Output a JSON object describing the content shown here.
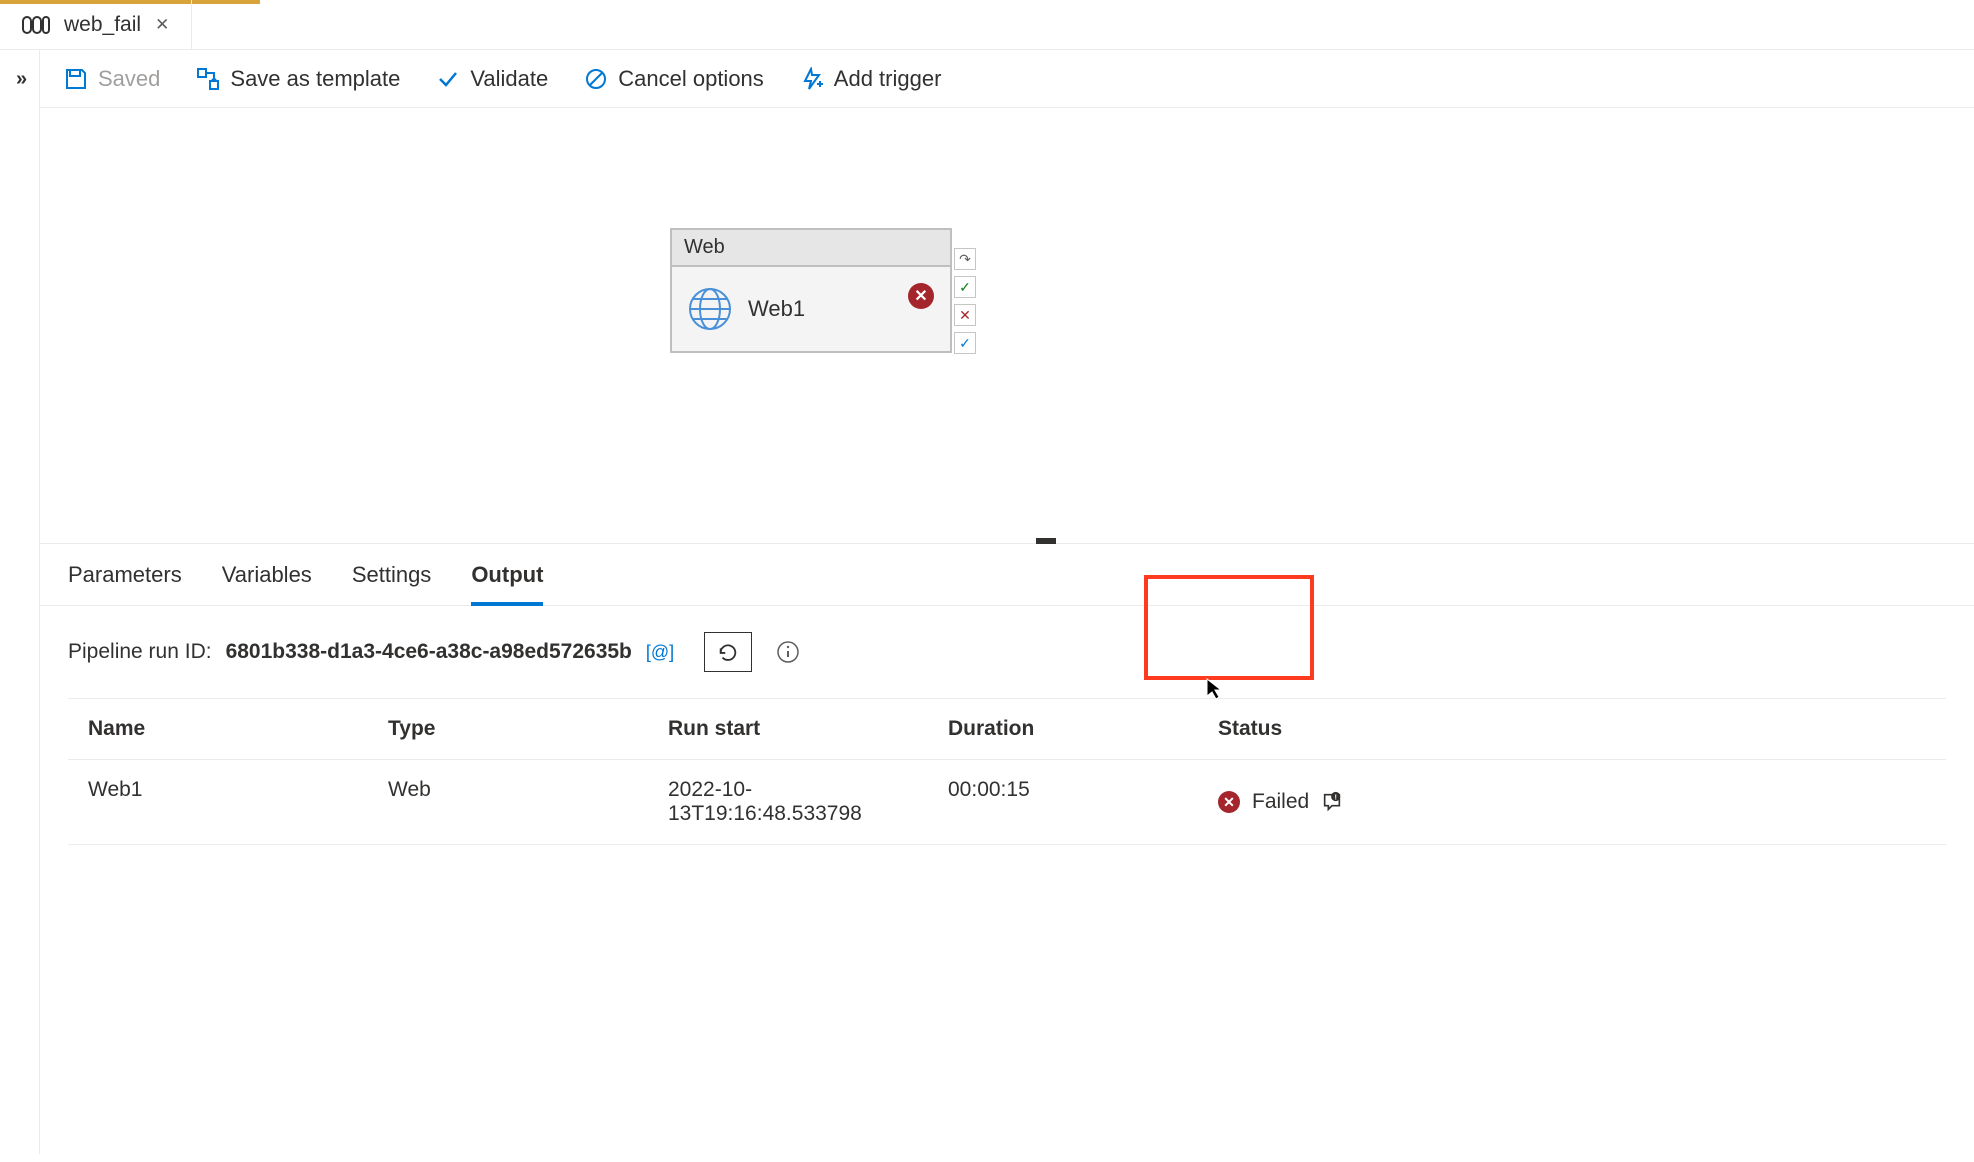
{
  "tab": {
    "title": "web_fail"
  },
  "toolbar": {
    "saved": "Saved",
    "save_template": "Save as template",
    "validate": "Validate",
    "cancel": "Cancel options",
    "add_trigger": "Add trigger"
  },
  "activity": {
    "type_label": "Web",
    "name": "Web1"
  },
  "bottom_tabs": {
    "parameters": "Parameters",
    "variables": "Variables",
    "settings": "Settings",
    "output": "Output"
  },
  "runinfo": {
    "label": "Pipeline run ID:",
    "value": "6801b338-d1a3-4ce6-a38c-a98ed572635b",
    "brackets": "[@]"
  },
  "table": {
    "headers": {
      "name": "Name",
      "type": "Type",
      "run_start": "Run start",
      "duration": "Duration",
      "status": "Status"
    },
    "rows": [
      {
        "name": "Web1",
        "type": "Web",
        "run_start": "2022-10-13T19:16:48.533798",
        "duration": "00:00:15",
        "status": "Failed"
      }
    ]
  }
}
